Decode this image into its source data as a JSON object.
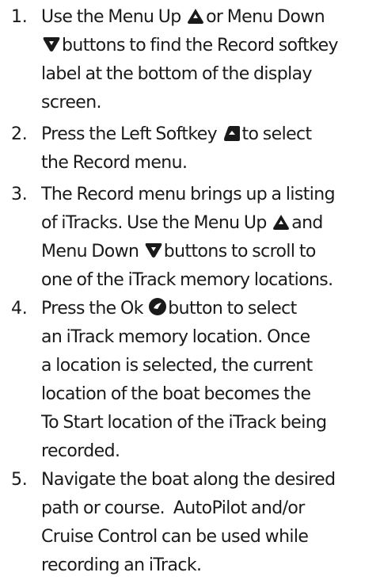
{
  "steps": [
    {
      "number": "1.",
      "lines": [
        {
          "a": "Use the Menu Up ",
          "icon": "menu-up-icon",
          "b": "or Menu Down"
        },
        {
          "a": "",
          "icon": "menu-down-icon",
          "b": "buttons to find the Record softkey"
        },
        {
          "a": "label at the bottom of the display"
        },
        {
          "a": "screen."
        }
      ]
    },
    {
      "number": "2.",
      "lines": [
        {
          "a": "Press the Left Softkey ",
          "icon": "left-softkey-icon",
          "b": "to select"
        },
        {
          "a": "the Record menu."
        }
      ]
    },
    {
      "number": "3.",
      "lines": [
        {
          "a": "The Record menu brings up a listing"
        },
        {
          "a": "of iTracks. Use the Menu Up ",
          "icon": "menu-up-icon",
          "b": "and"
        },
        {
          "a": "Menu Down ",
          "icon": "menu-down-icon",
          "b": "buttons to scroll to"
        },
        {
          "a": "one of the iTrack memory locations."
        }
      ]
    },
    {
      "number": "4.",
      "lines": [
        {
          "a": "Press the Ok ",
          "icon": "ok-button-icon",
          "b": "button to select"
        },
        {
          "a": "an iTrack memory location. Once"
        },
        {
          "a": "a location is selected, the current"
        },
        {
          "a": "location of the boat becomes the"
        },
        {
          "a": "To Start location of the iTrack being"
        },
        {
          "a": "recorded."
        }
      ]
    },
    {
      "number": "5.",
      "lines": [
        {
          "a": "Navigate the boat along the desired"
        },
        {
          "a": "path or course.  AutoPilot and/or"
        },
        {
          "a": "Cruise Control can be used while"
        },
        {
          "a": "recording an iTrack."
        }
      ]
    }
  ]
}
